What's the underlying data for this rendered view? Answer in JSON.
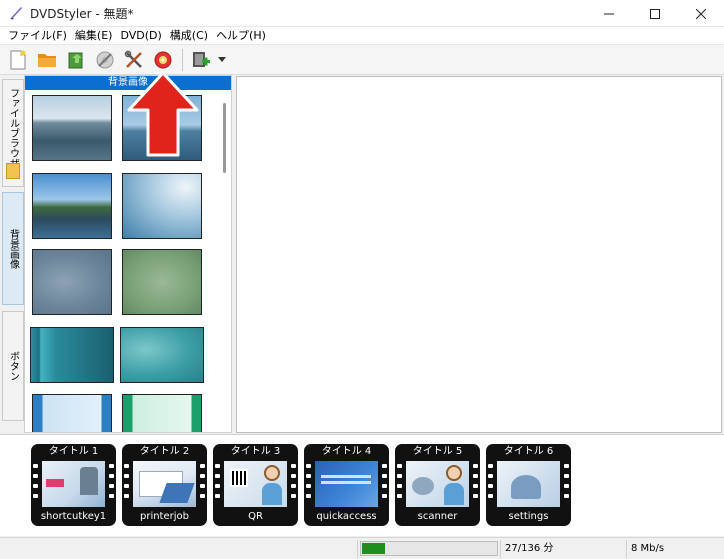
{
  "window": {
    "title": "DVDStyler - 無題*",
    "controls": [
      "minimize-icon",
      "maximize-icon",
      "close-icon"
    ]
  },
  "menu": [
    {
      "label": "ファイル(F)"
    },
    {
      "label": "編集(E)"
    },
    {
      "label": "DVD(D)"
    },
    {
      "label": "構成(C)"
    },
    {
      "label": "ヘルプ(H)"
    }
  ],
  "toolbar": {
    "buttons": [
      "new-file-icon",
      "open-folder-icon",
      "save-icon",
      "burn-disc-icon",
      "settings-tools-icon",
      "burn-dvd-icon",
      "add-video-icon",
      "dropdown-arrow-icon"
    ]
  },
  "side_tabs": [
    {
      "label": "ファイルブラウザー",
      "active": false
    },
    {
      "label": "背景画像",
      "active": true
    },
    {
      "label": "ボタン",
      "active": false
    }
  ],
  "browser": {
    "header": "背景画像",
    "thumbnails": [
      "sea-landscape",
      "sea-horizon",
      "coast-landscape",
      "blue-wave",
      "gray-blue-blur",
      "green-blur",
      "teal-stripes",
      "teal-texture",
      "light-blue-frame",
      "mint-frame"
    ]
  },
  "annotation": {
    "arrow_color": "#e0231b"
  },
  "titles": [
    {
      "header": "タイトル 1",
      "name": "shortcutkey1"
    },
    {
      "header": "タイトル 2",
      "name": "printerjob"
    },
    {
      "header": "タイトル 3",
      "name": "QR"
    },
    {
      "header": "タイトル 4",
      "name": "quickaccess"
    },
    {
      "header": "タイトル 5",
      "name": "scanner"
    },
    {
      "header": "タイトル 6",
      "name": "settings"
    }
  ],
  "status": {
    "progress_fraction": 0.17,
    "duration": "27/136 分",
    "bitrate": "8 Mb/s"
  },
  "colors": {
    "accent": "#0a6fd0",
    "progress": "#1e8f1e"
  }
}
